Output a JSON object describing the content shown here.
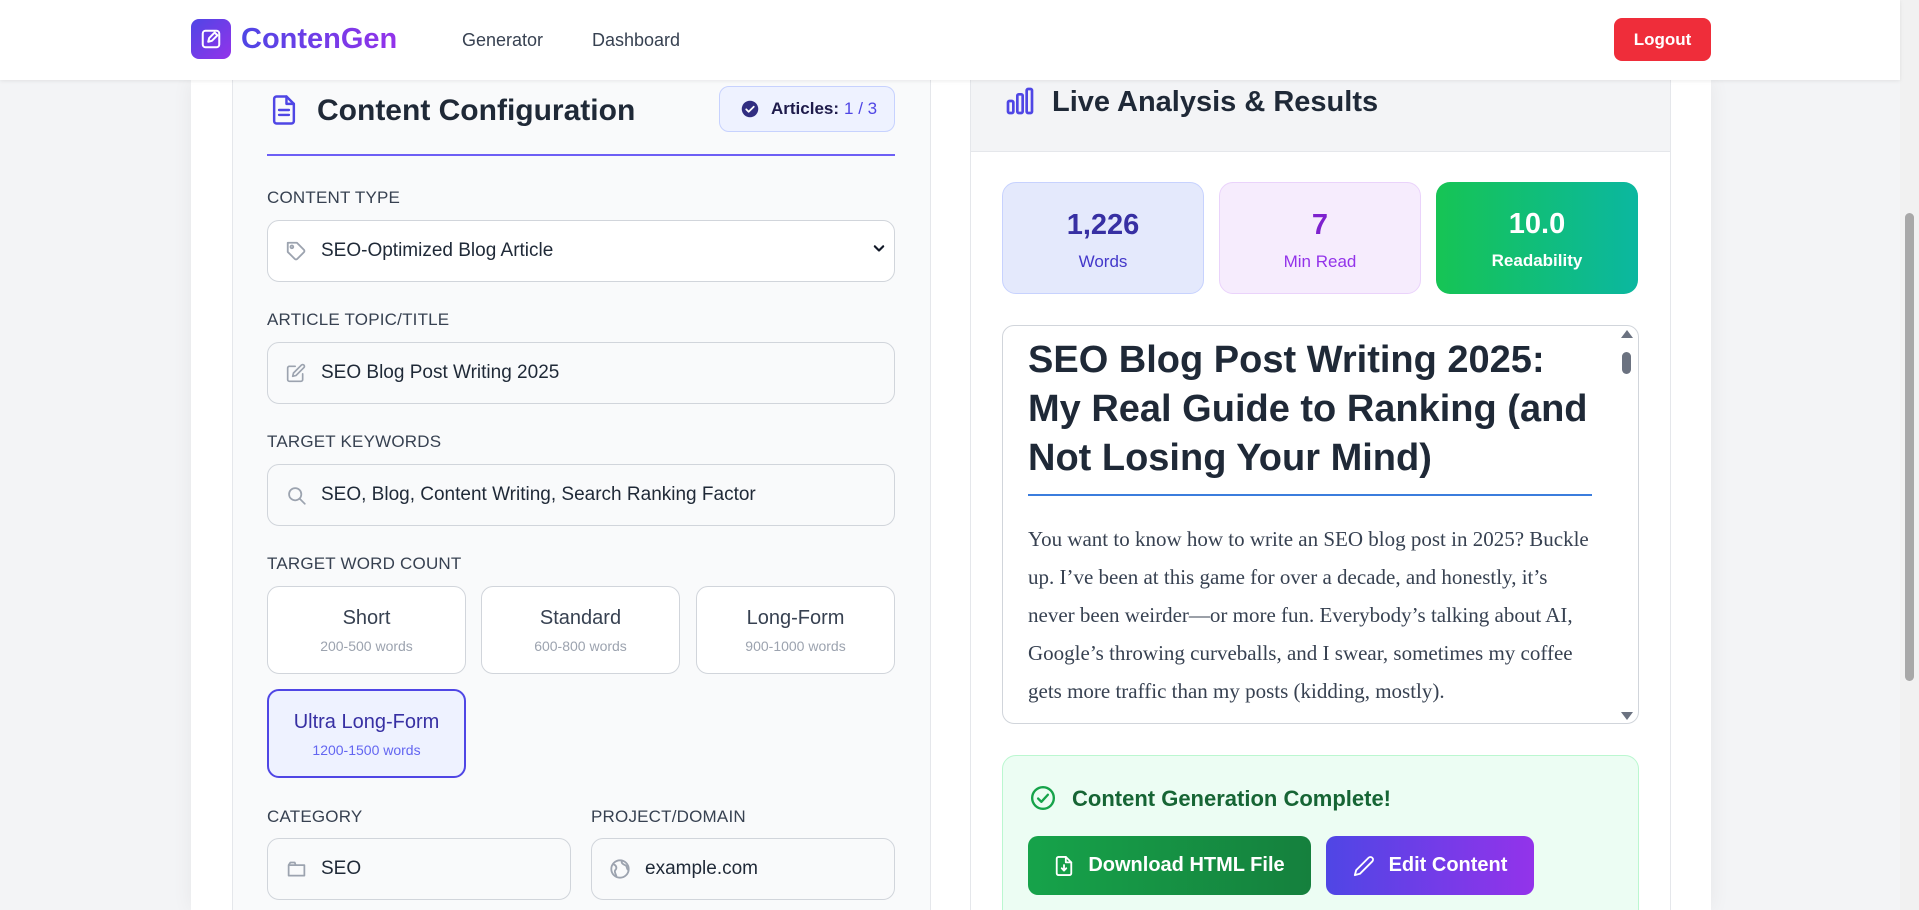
{
  "nav": {
    "brand": "ContenGen",
    "links": [
      "Generator",
      "Dashboard"
    ],
    "logout_label": "Logout"
  },
  "config": {
    "title": "Content Configuration",
    "articles_label": "Articles:",
    "articles_count": "1 / 3",
    "content_type": {
      "label": "CONTENT TYPE",
      "value": "SEO-Optimized Blog Article"
    },
    "topic": {
      "label": "ARTICLE TOPIC/TITLE",
      "value": "SEO Blog Post Writing 2025"
    },
    "keywords": {
      "label": "TARGET KEYWORDS",
      "value": "SEO, Blog, Content Writing, Search Ranking Factor"
    },
    "word_count": {
      "label": "TARGET WORD COUNT",
      "options": [
        {
          "title": "Short",
          "range": "200-500 words"
        },
        {
          "title": "Standard",
          "range": "600-800 words"
        },
        {
          "title": "Long-Form",
          "range": "900-1000 words"
        },
        {
          "title": "Ultra Long-Form",
          "range": "1200-1500 words"
        }
      ],
      "selected": "Ultra Long-Form"
    },
    "category": {
      "label": "CATEGORY",
      "value": "SEO"
    },
    "project": {
      "label": "PROJECT/DOMAIN",
      "value": "example.com"
    }
  },
  "analysis": {
    "title": "Live Analysis & Results",
    "stats": {
      "words": {
        "value": "1,226",
        "label": "Words"
      },
      "read": {
        "value": "7",
        "label": "Min Read"
      },
      "readability": {
        "value": "10.0",
        "label": "Readability"
      }
    },
    "preview": {
      "heading": "SEO Blog Post Writing 2025: My Real Guide to Ranking (and Not Losing Your Mind)",
      "body": "You want to know how to write an SEO blog post in 2025? Buckle up. I’ve been at this game for over a decade, and honestly, it’s never been weirder—or more fun. Everybody’s talking about AI, Google’s throwing curveballs, and I swear, sometimes my coffee gets more traffic than my posts (kidding, mostly)."
    },
    "complete": {
      "title": "Content Generation Complete!",
      "download_label": "Download HTML File",
      "edit_label": "Edit Content"
    }
  },
  "colors": {
    "accent": "#4f46e5",
    "accent2": "#9333ea",
    "danger": "#ef2d3a",
    "success": "#16a34a"
  },
  "icons": [
    "edit-square-icon",
    "document-icon",
    "check-circle-icon",
    "tag-icon",
    "chevron-down-icon",
    "pencil-icon",
    "search-icon",
    "folder-icon",
    "globe-icon",
    "bar-chart-icon",
    "download-file-icon"
  ]
}
